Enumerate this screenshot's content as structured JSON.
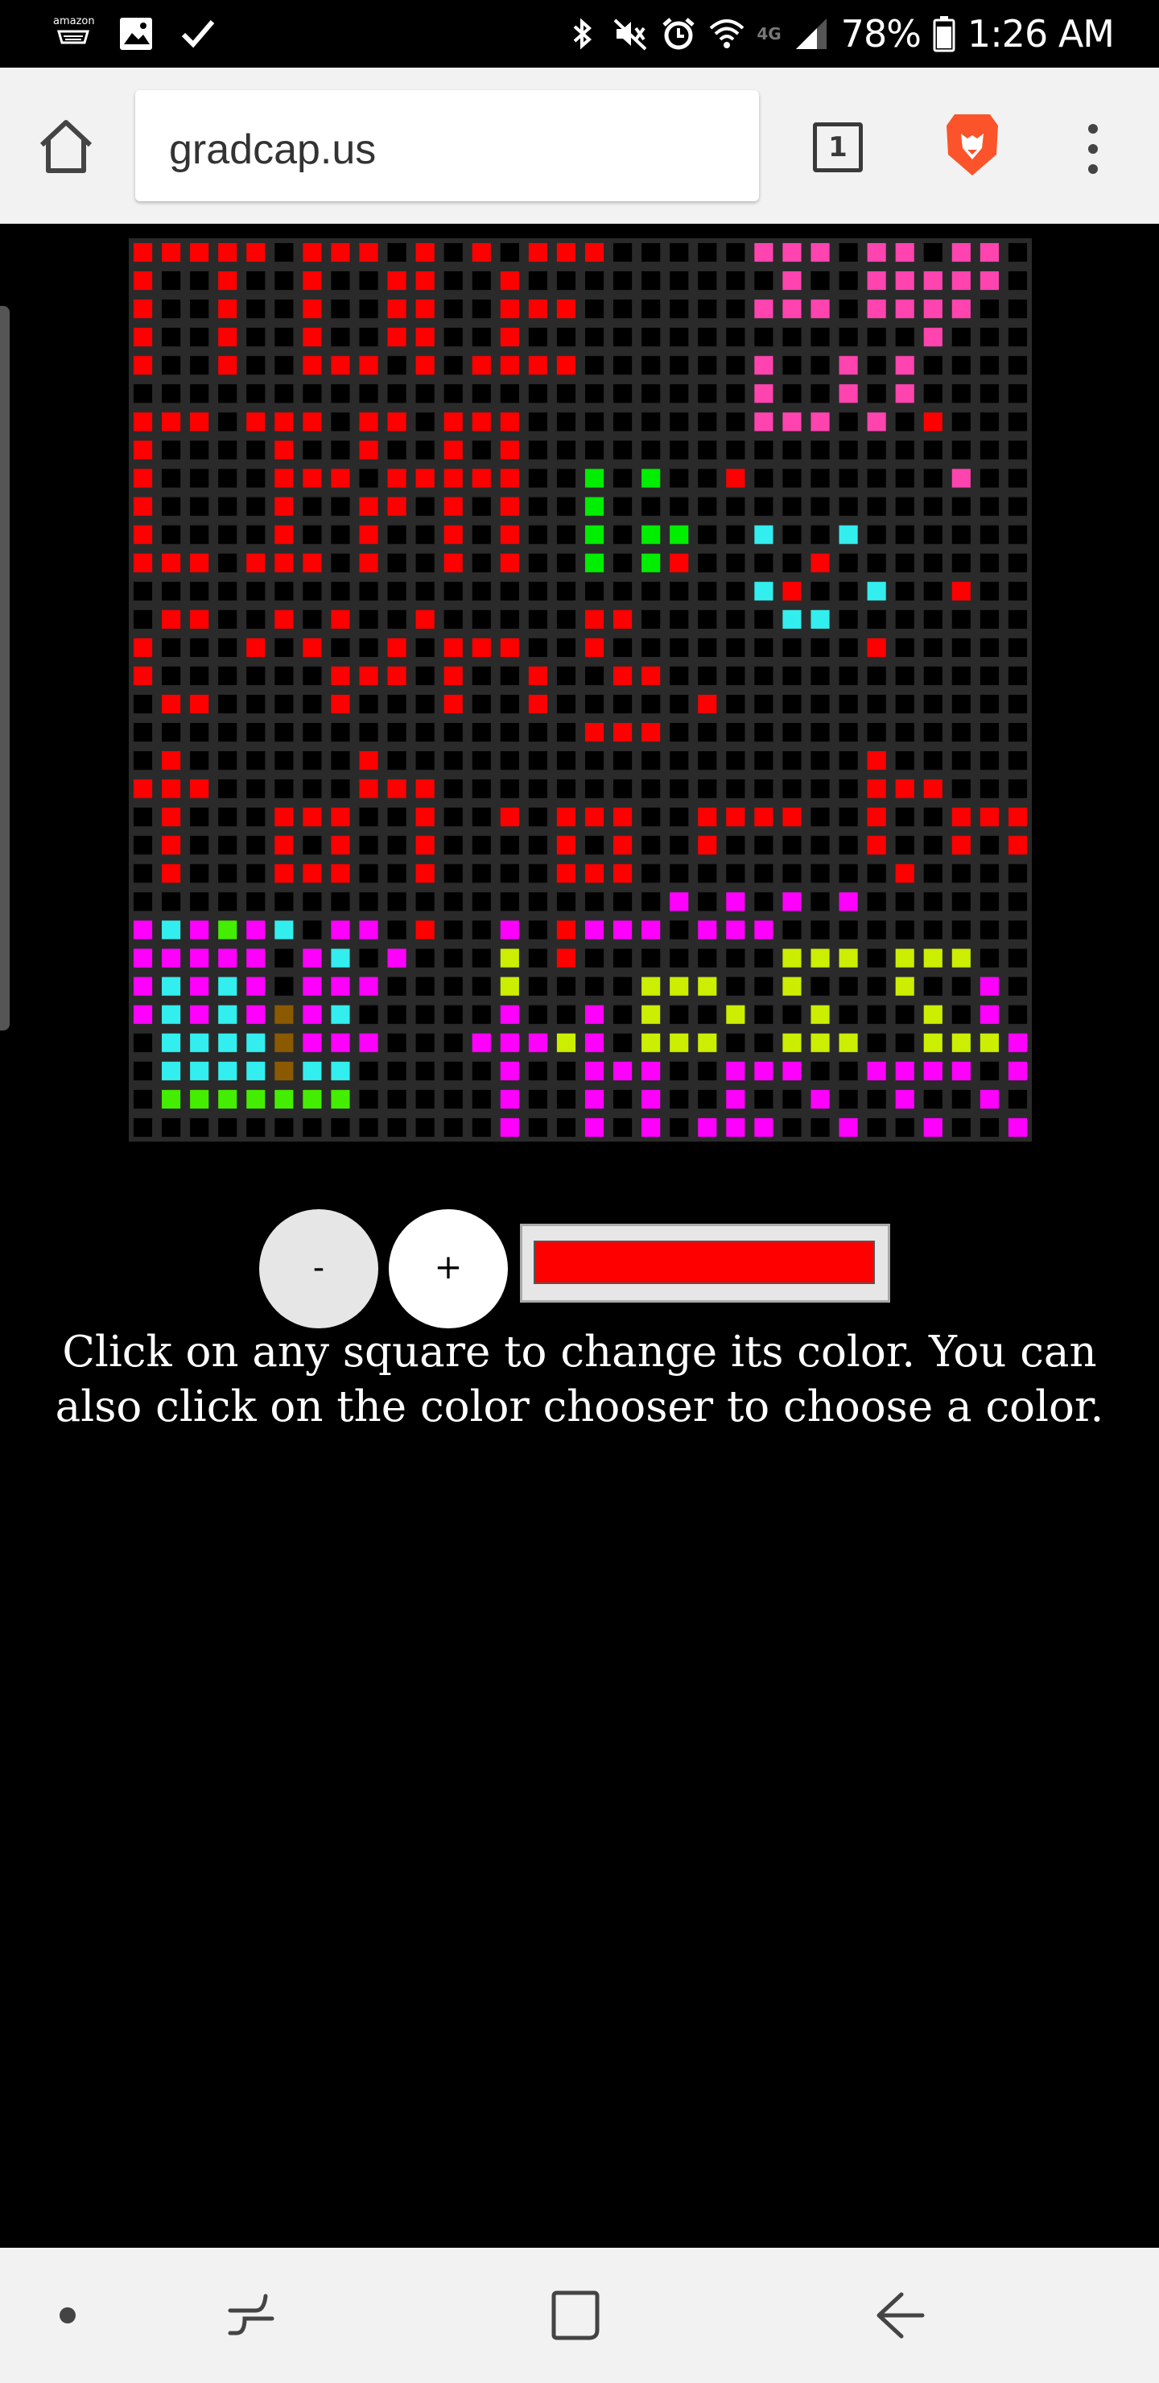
{
  "status_bar": {
    "amazon_label": "amazon",
    "battery": "78%",
    "time": "1:26 AM",
    "network": "4G"
  },
  "browser": {
    "url": "gradcap.us",
    "tab_count": "1"
  },
  "grid": {
    "size": 32,
    "palette": {
      ".": "#000000",
      "R": "#ff0000",
      "P": "#ff44b0",
      "G": "#00ee00",
      "C": "#33eeee",
      "M": "#ff00ff",
      "Y": "#ccee00",
      "B": "#8b5a00",
      "L": "#44ee00"
    },
    "rows": [
      "RRRRR.RRR.R.R.RRR.....PPP.PP.PP.",
      "R..R..R..RR..R.........P..PPPPP.",
      "R..R..R..RR..RRR......PPP.PPPP..",
      "R..R..R..RR..R..............P...",
      "R..R..RRR.R.RRRR......P..P.P....",
      "......................P..P.P....",
      "RRR.RRR.RR.RRR........PPP.P.R...",
      "R....R..R..R.R..................",
      "R....RRR.RRRRR..G.G..R.......P..",
      "R....R..RR.R.R..G...............",
      "R....R..R..R.R..G.GG..C..C......",
      "RRR.RRR.R..R.R..G.GR....R.......",
      "......................CR..C..R..",
      ".RR..R.R..R.....RR.....CC.......",
      "R...R.R..R.RRR..R.........R.....",
      "R......RRR.R..R..RR.............",
      ".RR....R...R..R.....R...........",
      "................RRR.............",
      ".R......R.................R.....",
      "RRR.....RRR...............RRR...",
      ".R...RRR..R..R.RRR..RRRR..R..RRR",
      ".R...R.R..R....R.R..R.....R..R.R",
      ".R...RRR..R....RRR.........R....",
      "...................M.M.M.M......",
      "MCMLMC.MM.R..M.RMMM.MMM........",
      "MMMMM.MC.M...Y.R.......YYY.YYY..",
      "MCMCM.MMM....Y....YYY..Y...Y..M.",
      "MCMCMBMC.....M..M.Y..Y..Y...Y.M.M",
      ".CCCCBMMM...MMMYM.YYY..YYY..YYYM.M",
      ".CCCCBCC.....M..MMM..MMM..MMMM.MM",
      ".LLLLLLL.....M..M.M..M..M..M..M.M",
      ".............M..M.M.MMM..M..M..M.M"
    ]
  },
  "controls": {
    "minus_label": "-",
    "plus_label": "+",
    "selected_color": "#ff0000"
  },
  "instructions": "Click on any square to change its color. You can also click on the color chooser to choose a color."
}
